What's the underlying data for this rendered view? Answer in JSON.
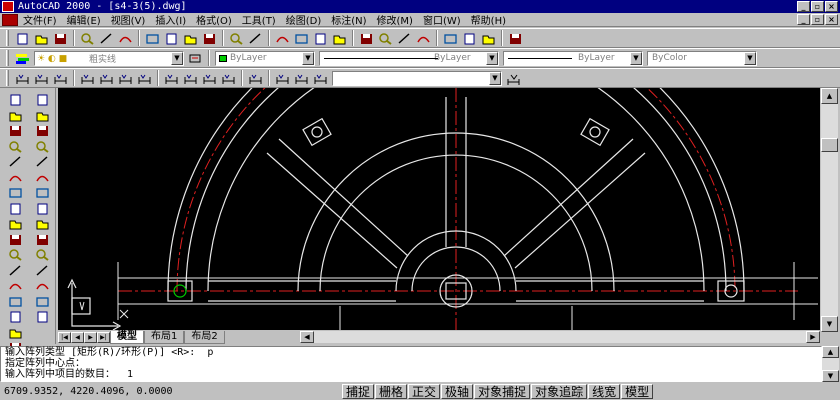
{
  "window": {
    "title": "AutoCAD 2000 - [s4-3(5).dwg]"
  },
  "menu": [
    "文件(F)",
    "编辑(E)",
    "视图(V)",
    "插入(I)",
    "格式(O)",
    "工具(T)",
    "绘图(D)",
    "标注(N)",
    "修改(M)",
    "窗口(W)",
    "帮助(H)"
  ],
  "toolbar": {
    "layer_value": "粗实线",
    "color_value": "ByLayer",
    "linetype_value": "ByLayer",
    "lineweight_value": "ByLayer",
    "plotstyle_value": "ByColor"
  },
  "icons": {
    "std": [
      "new-icon",
      "open-icon",
      "save-icon",
      "print-icon",
      "preview-icon",
      "find-icon",
      "cut-icon",
      "copy-icon",
      "paste-icon",
      "match-icon",
      "undo-icon",
      "redo-icon",
      "hyperlink-icon",
      "snap-from-icon",
      "dbconnect-icon",
      "adcenter-icon",
      "pan-icon",
      "zoom-realtime-icon",
      "zoom-window-icon",
      "zoom-previous-icon",
      "properties-icon",
      "design-center-icon",
      "today-icon",
      "help-icon"
    ],
    "draw": [
      "line-icon",
      "construction-line-icon",
      "polyline-icon",
      "polygon-icon",
      "rectangle-icon",
      "arc-icon",
      "circle-icon",
      "revision-cloud-icon",
      "spline-icon",
      "ellipse-icon",
      "ellipse-arc-icon",
      "insert-block-icon",
      "make-block-icon",
      "point-icon",
      "hatch-icon",
      "region-icon",
      "table-icon",
      "mtext-icon"
    ],
    "modify": [
      "erase-icon",
      "copy-object-icon",
      "mirror-icon",
      "offset-icon",
      "array-icon",
      "move-icon",
      "rotate-icon",
      "scale-icon",
      "stretch-icon",
      "trim-icon",
      "extend-icon",
      "break-icon",
      "chamfer-icon",
      "fillet-icon",
      "explode-icon"
    ]
  },
  "tabs": [
    "模型",
    "布局1",
    "布局2"
  ],
  "command": {
    "lines": [
      "输入阵列类型 [矩形(R)/环形(P)] <R>:  p",
      "指定阵列中心点：",
      "输入阵列中项目的数目：  1"
    ]
  },
  "status": {
    "coords": "6709.9352, 4220.4096, 0.0000",
    "buttons": [
      "捕捉",
      "栅格",
      "正交",
      "极轴",
      "对象捕捉",
      "对象追踪",
      "线宽",
      "模型"
    ]
  }
}
